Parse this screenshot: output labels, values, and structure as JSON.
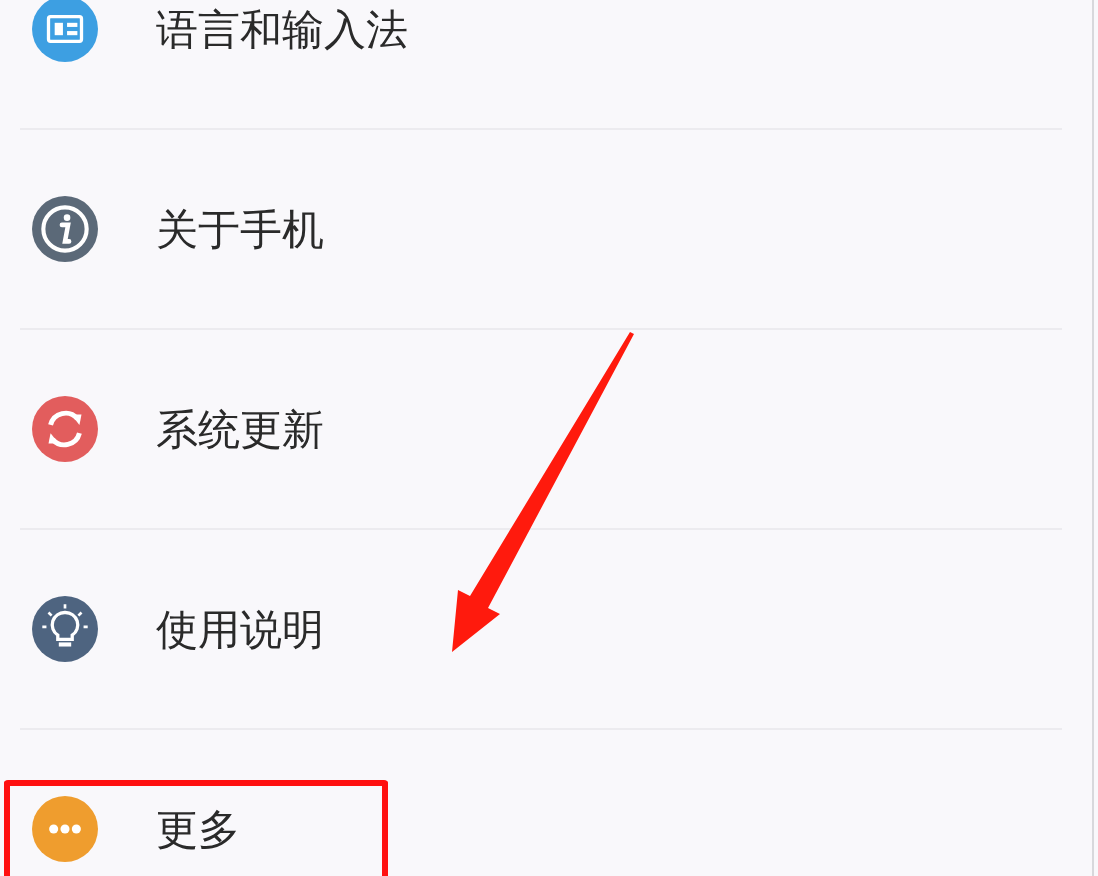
{
  "settings_list": [
    {
      "kind": "language",
      "label": "语言和输入法",
      "highlighted": false
    },
    {
      "kind": "info",
      "label": "关于手机",
      "highlighted": false
    },
    {
      "kind": "update",
      "label": "系统更新",
      "highlighted": false
    },
    {
      "kind": "help",
      "label": "使用说明",
      "highlighted": false
    },
    {
      "kind": "more",
      "label": "更多",
      "highlighted": true
    }
  ]
}
